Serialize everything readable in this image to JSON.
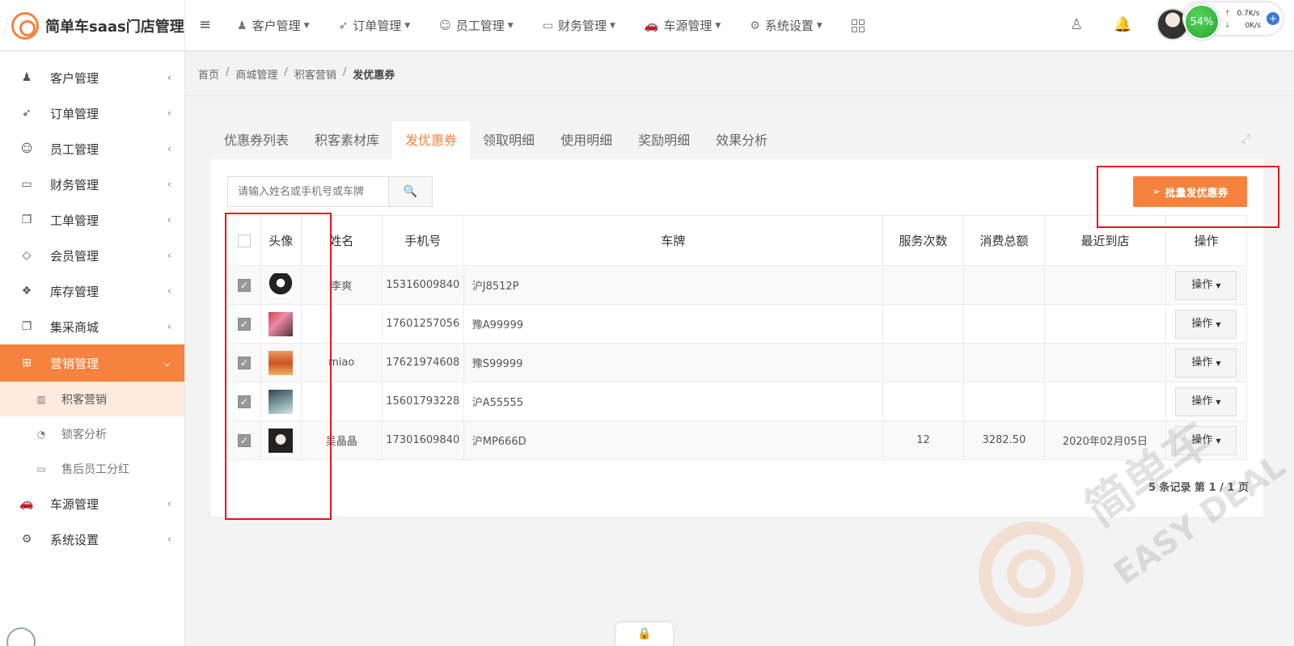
{
  "header": {
    "logo_text": "简单车saas门店管理",
    "nav": [
      {
        "label": "客户管理",
        "icon": "users-icon"
      },
      {
        "label": "订单管理",
        "icon": "rocket-icon"
      },
      {
        "label": "员工管理",
        "icon": "user-icon"
      },
      {
        "label": "财务管理",
        "icon": "folder-icon"
      },
      {
        "label": "车源管理",
        "icon": "car-icon"
      },
      {
        "label": "系统设置",
        "icon": "gear-icon"
      }
    ],
    "net_widget": {
      "percent": "54%",
      "up": "0.7K/s",
      "down": "0K/s"
    }
  },
  "sidebar": {
    "items": [
      {
        "label": "客户管理",
        "icon": "users-icon"
      },
      {
        "label": "订单管理",
        "icon": "rocket-icon"
      },
      {
        "label": "员工管理",
        "icon": "user-icon"
      },
      {
        "label": "财务管理",
        "icon": "folder-icon"
      },
      {
        "label": "工单管理",
        "icon": "copy-icon"
      },
      {
        "label": "会员管理",
        "icon": "diamond-icon"
      },
      {
        "label": "库存管理",
        "icon": "dropbox-icon"
      },
      {
        "label": "集采商城",
        "icon": "copy-icon"
      },
      {
        "label": "营销管理",
        "icon": "gift-icon"
      }
    ],
    "sub_items": [
      {
        "label": "积客营销",
        "icon": "bar-chart-icon"
      },
      {
        "label": "锁客分析",
        "icon": "pie-chart-icon"
      },
      {
        "label": "售后员工分红",
        "icon": "folder-icon"
      }
    ],
    "bottom_items": [
      {
        "label": "车源管理",
        "icon": "car-icon"
      },
      {
        "label": "系统设置",
        "icon": "gear-icon"
      }
    ]
  },
  "breadcrumb": [
    "首页",
    "商城管理",
    "积客营销",
    "发优惠券"
  ],
  "tabs": [
    "优惠券列表",
    "积客素材库",
    "发优惠券",
    "领取明细",
    "使用明细",
    "奖励明细",
    "效果分析"
  ],
  "search": {
    "placeholder": "请输入姓名或手机号或车牌"
  },
  "batch_button": "批量发优惠券",
  "table": {
    "headers": [
      "头像",
      "姓名",
      "手机号",
      "车牌",
      "服务次数",
      "消费总额",
      "最近到店",
      "操作"
    ],
    "op_label": "操作",
    "rows": [
      {
        "name": "李爽",
        "phone": "15316009840",
        "plate": "沪J8512P",
        "services": "",
        "total": "",
        "last": ""
      },
      {
        "name": "",
        "phone": "17601257056",
        "plate": "豫A99999",
        "services": "",
        "total": "",
        "last": ""
      },
      {
        "name": "miao",
        "phone": "17621974608",
        "plate": "豫S99999",
        "services": "",
        "total": "",
        "last": ""
      },
      {
        "name": "",
        "phone": "15601793228",
        "plate": "沪A55555",
        "services": "",
        "total": "",
        "last": ""
      },
      {
        "name": "吴晶晶",
        "phone": "17301609840",
        "plate": "沪MP666D",
        "services": "12",
        "total": "3282.50",
        "last": "2020年02月05日"
      }
    ]
  },
  "pager": "5 条记录 第 1 / 1 页",
  "watermark": {
    "cn": "简单车",
    "en": "EASY DEAL"
  },
  "colors": {
    "accent": "#f5823e",
    "highlight_box": "#e8141a"
  }
}
